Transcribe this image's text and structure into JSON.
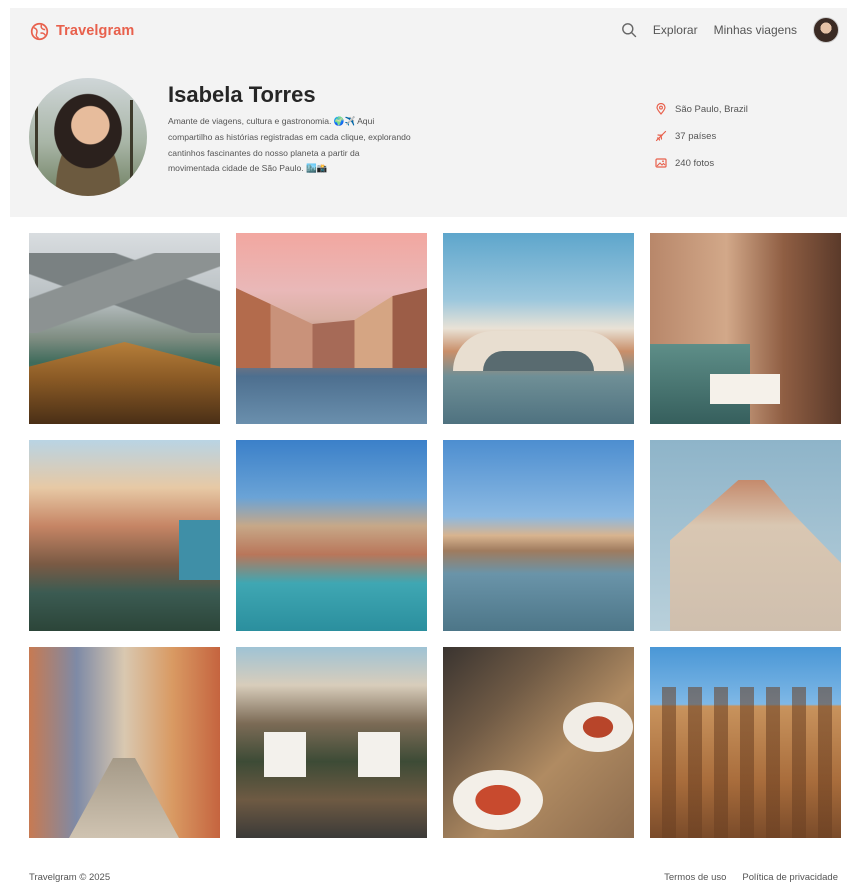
{
  "brand": {
    "name": "Travelgram",
    "accent": "#e8604c"
  },
  "nav": {
    "search_icon": "search-icon",
    "links": [
      "Explorar",
      "Minhas viagens"
    ]
  },
  "profile": {
    "name": "Isabela Torres",
    "bio": "Amante de viagens, cultura e gastronomia. 🌍✈️ Aqui compartilho as histórias registradas em cada clique, explorando cantinhos fascinantes do nosso planeta a partir da movimentada cidade de São Paulo. 🏙️📸",
    "stats": [
      {
        "icon": "location-pin-icon",
        "label": "São Paulo, Brazil"
      },
      {
        "icon": "airplane-icon",
        "label": "37 países"
      },
      {
        "icon": "photo-icon",
        "label": "240 fotos"
      }
    ]
  },
  "photos": [
    {
      "subject": "mountain-lake-boat"
    },
    {
      "subject": "venice-canal-sunset"
    },
    {
      "subject": "rialto-bridge"
    },
    {
      "subject": "venice-restaurant"
    },
    {
      "subject": "cinque-terre-cliff"
    },
    {
      "subject": "vernazza-harbor"
    },
    {
      "subject": "ponte-vecchio"
    },
    {
      "subject": "florence-duomo"
    },
    {
      "subject": "narrow-street-scooter"
    },
    {
      "subject": "cafe-barrels"
    },
    {
      "subject": "dinner-table"
    },
    {
      "subject": "colosseum"
    }
  ],
  "footer": {
    "copyright": "Travelgram © 2025",
    "links": [
      "Termos de uso",
      "Política de privacidade"
    ]
  }
}
